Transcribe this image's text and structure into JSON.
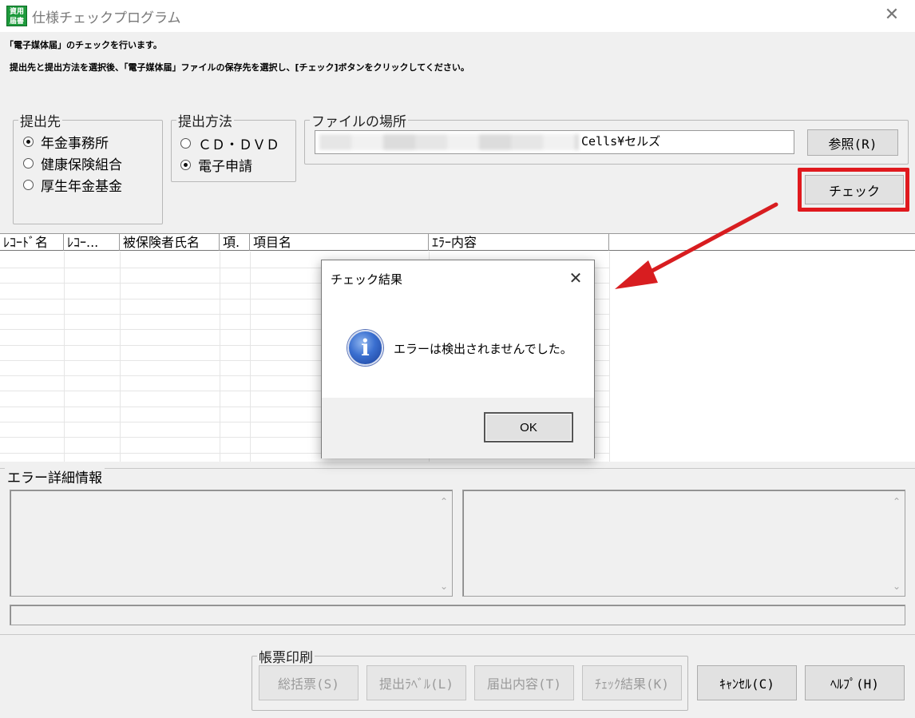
{
  "window": {
    "title": "仕様チェックプログラム",
    "icon_text": [
      "資用",
      "届書"
    ],
    "close_glyph": "✕"
  },
  "instructions": {
    "line1": "「電子媒体届」のチェックを行います。",
    "line2": "提出先と提出方法を選択後、「電子媒体届」ファイルの保存先を選択し、[チェック]ボタンをクリックしてください。"
  },
  "submit_to": {
    "legend": "提出先",
    "options": [
      {
        "label": "年金事務所",
        "checked": true
      },
      {
        "label": "健康保険組合",
        "checked": false
      },
      {
        "label": "厚生年金基金",
        "checked": false
      }
    ]
  },
  "submit_method": {
    "legend": "提出方法",
    "options": [
      {
        "label": "ＣＤ・ＤＶＤ",
        "checked": false
      },
      {
        "label": "電子申請",
        "checked": true
      }
    ]
  },
  "file_location": {
    "legend": "ファイルの場所",
    "path_visible": "Cells¥セルズ",
    "browse_label": "参照(R)"
  },
  "check_button": {
    "label": "チェック"
  },
  "grid": {
    "columns": [
      "ﾚｺｰﾄﾞ名",
      "ﾚｺｰ...",
      "被保険者氏名",
      "項.",
      "項目名",
      "ｴﾗｰ内容"
    ],
    "rows": []
  },
  "error_detail": {
    "legend": "エラー詳細情報"
  },
  "print_group": {
    "legend": "帳票印刷",
    "buttons": [
      "総括票(S)",
      "提出ﾗﾍﾞﾙ(L)",
      "届出内容(T)",
      "ﾁｪｯｸ結果(K)"
    ]
  },
  "cancel_button": {
    "label": "ｷｬﾝｾﾙ(C)"
  },
  "help_button": {
    "label": "ﾍﾙﾌﾟ(H)"
  },
  "dialog": {
    "title": "チェック結果",
    "message": "エラーは検出されませんでした。",
    "ok_label": "OK",
    "icon": "info-icon"
  },
  "colors": {
    "highlight": "#e0191e",
    "arrow": "#d81d20",
    "app_icon": "#1e9a3c"
  }
}
